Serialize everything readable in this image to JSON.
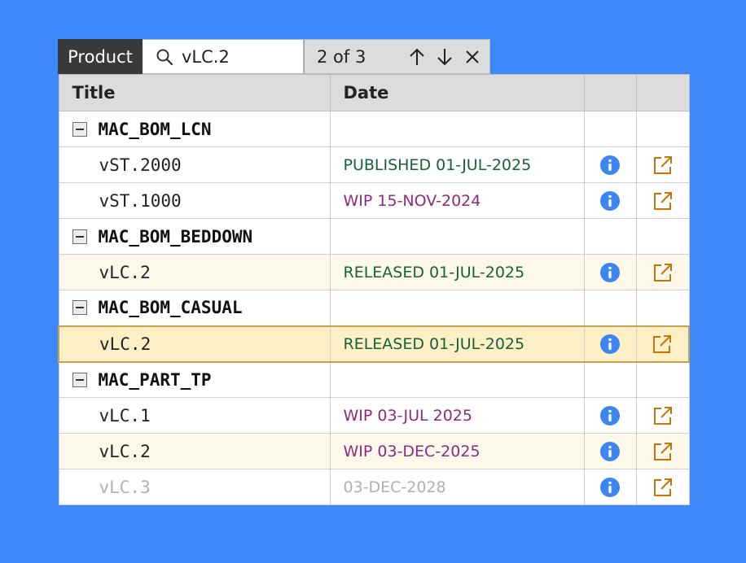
{
  "search": {
    "scope_label": "Product",
    "query": "vLC.2",
    "match_text": "2 of 3"
  },
  "table": {
    "headers": [
      "Title",
      "Date",
      "",
      ""
    ],
    "groups": [
      {
        "name": "MAC_BOM_LCN",
        "rows": [
          {
            "version": "vST.2000",
            "date": "PUBLISHED 01-JUL-2025",
            "status_color": "#15613b"
          },
          {
            "version": "vST.1000",
            "date": "WIP 15-NOV-2024",
            "status_color": "#8d2a7c"
          }
        ]
      },
      {
        "name": "MAC_BOM_BEDDOWN",
        "rows": [
          {
            "version": "vLC.2",
            "date": "RELEASED 01-JUL-2025",
            "status_color": "#15613b"
          }
        ]
      },
      {
        "name": "MAC_BOM_CASUAL",
        "rows": [
          {
            "version": "vLC.2",
            "date": "RELEASED 01-JUL-2025",
            "status_color": "#15613b"
          }
        ]
      },
      {
        "name": "MAC_PART_TP",
        "rows": [
          {
            "version": "vLC.1",
            "date": "WIP 03-JUL 2025",
            "status_color": "#8d2a7c"
          },
          {
            "version": "vLC.2",
            "date": "WIP 03-DEC-2025",
            "status_color": "#8d2a7c"
          },
          {
            "version": "vLC.3",
            "date": "03-DEC-2028",
            "status_color": "#b0b0b0"
          }
        ]
      }
    ]
  },
  "icons": {
    "search": "magnifier-icon",
    "prev": "arrow-up-icon",
    "next": "arrow-down-icon",
    "close": "close-icon",
    "collapse": "minus-box-icon",
    "info": "info-circle-icon",
    "open": "open-external-icon"
  },
  "colors": {
    "background": "#3f88fb",
    "match_highlight": "#fdf9ea",
    "current_match": "#fdefc6",
    "current_match_border": "#c9a04a",
    "info_blue": "#3d85f0",
    "open_orange": "#c7740a"
  }
}
